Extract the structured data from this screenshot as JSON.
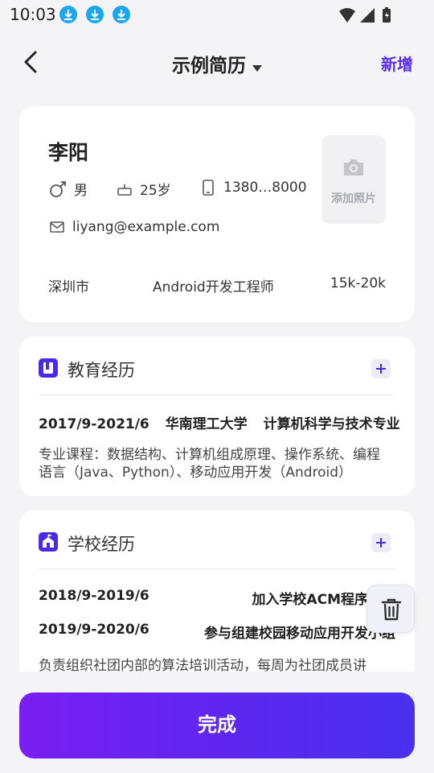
{
  "status_bar": {
    "time": "10:03",
    "icons": [
      "download-icon",
      "download-icon",
      "download-icon",
      "wifi-icon",
      "signal-icon",
      "battery-icon"
    ]
  },
  "header": {
    "back_icon": "chevron-left-icon",
    "title": "示例简历",
    "title_dropdown_icon": "caret-down-icon",
    "add_label": "新增"
  },
  "profile": {
    "name": "李阳",
    "gender": "男",
    "age": "25岁",
    "phone": "1380…8000",
    "email": "liyang@example.com",
    "photo_label": "添加照片",
    "city": "深圳市",
    "position": "Android开发工程师",
    "salary": "15k-20k"
  },
  "education": {
    "title": "教育经历",
    "items": [
      {
        "period": "2017/9-2021/6",
        "school": "华南理工大学",
        "major": "计算机科学与技术专业",
        "description": "专业课程：数据结构、计算机组成原理、操作系统、编程语言（Java、Python）、移动应用开发（Android）"
      }
    ]
  },
  "school_experience": {
    "title": "学校经历",
    "items": [
      {
        "period": "2018/9-2019/6",
        "name": "加入学校ACM程序设计"
      },
      {
        "period": "2019/9-2020/6",
        "name": "参与组建校园移动应用开发小组"
      }
    ],
    "description": "负责组织社团内部的算法培训活动，每周为社团成员讲"
  },
  "actions": {
    "done_label": "完成",
    "delete_icon": "trash-icon"
  },
  "colors": {
    "accent": "#5b2ee8",
    "section_icon": "#4b2ae0",
    "status_download": "#1aa7f0",
    "background": "#f4f4f6"
  }
}
